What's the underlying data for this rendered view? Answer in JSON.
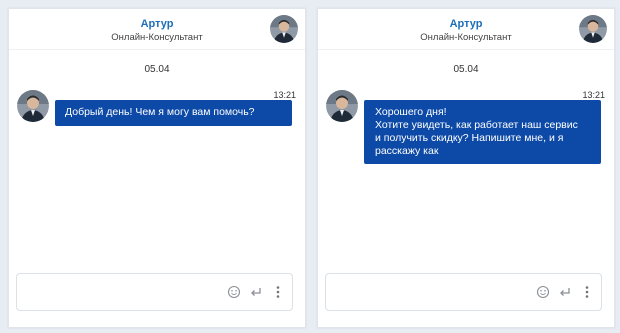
{
  "panels": [
    {
      "agent_name": "Артур",
      "agent_role": "Онлайн-Консультант",
      "date": "05.04",
      "message": {
        "time": "13:21",
        "lines": [
          "Добрый день! Чем я могу вам помочь?"
        ]
      },
      "composer": {
        "placeholder": "",
        "icons": [
          "emoji-icon",
          "enter-icon",
          "more-vertical-icon"
        ]
      }
    },
    {
      "agent_name": "Артур",
      "agent_role": "Онлайн-Консультант",
      "date": "05.04",
      "message": {
        "time": "13:21",
        "lines": [
          "Хорошего дня!",
          "Хотите увидеть, как работает наш  сервис",
          "и получить скидку? Напишите мне, и я",
          "расскажу как"
        ]
      },
      "composer": {
        "placeholder": "",
        "icons": [
          "emoji-icon",
          "enter-icon",
          "more-vertical-icon"
        ]
      }
    }
  ],
  "colors": {
    "bubble": "#0d4aa7",
    "agent_name": "#1d6fb8",
    "background": "#e7edf3"
  }
}
